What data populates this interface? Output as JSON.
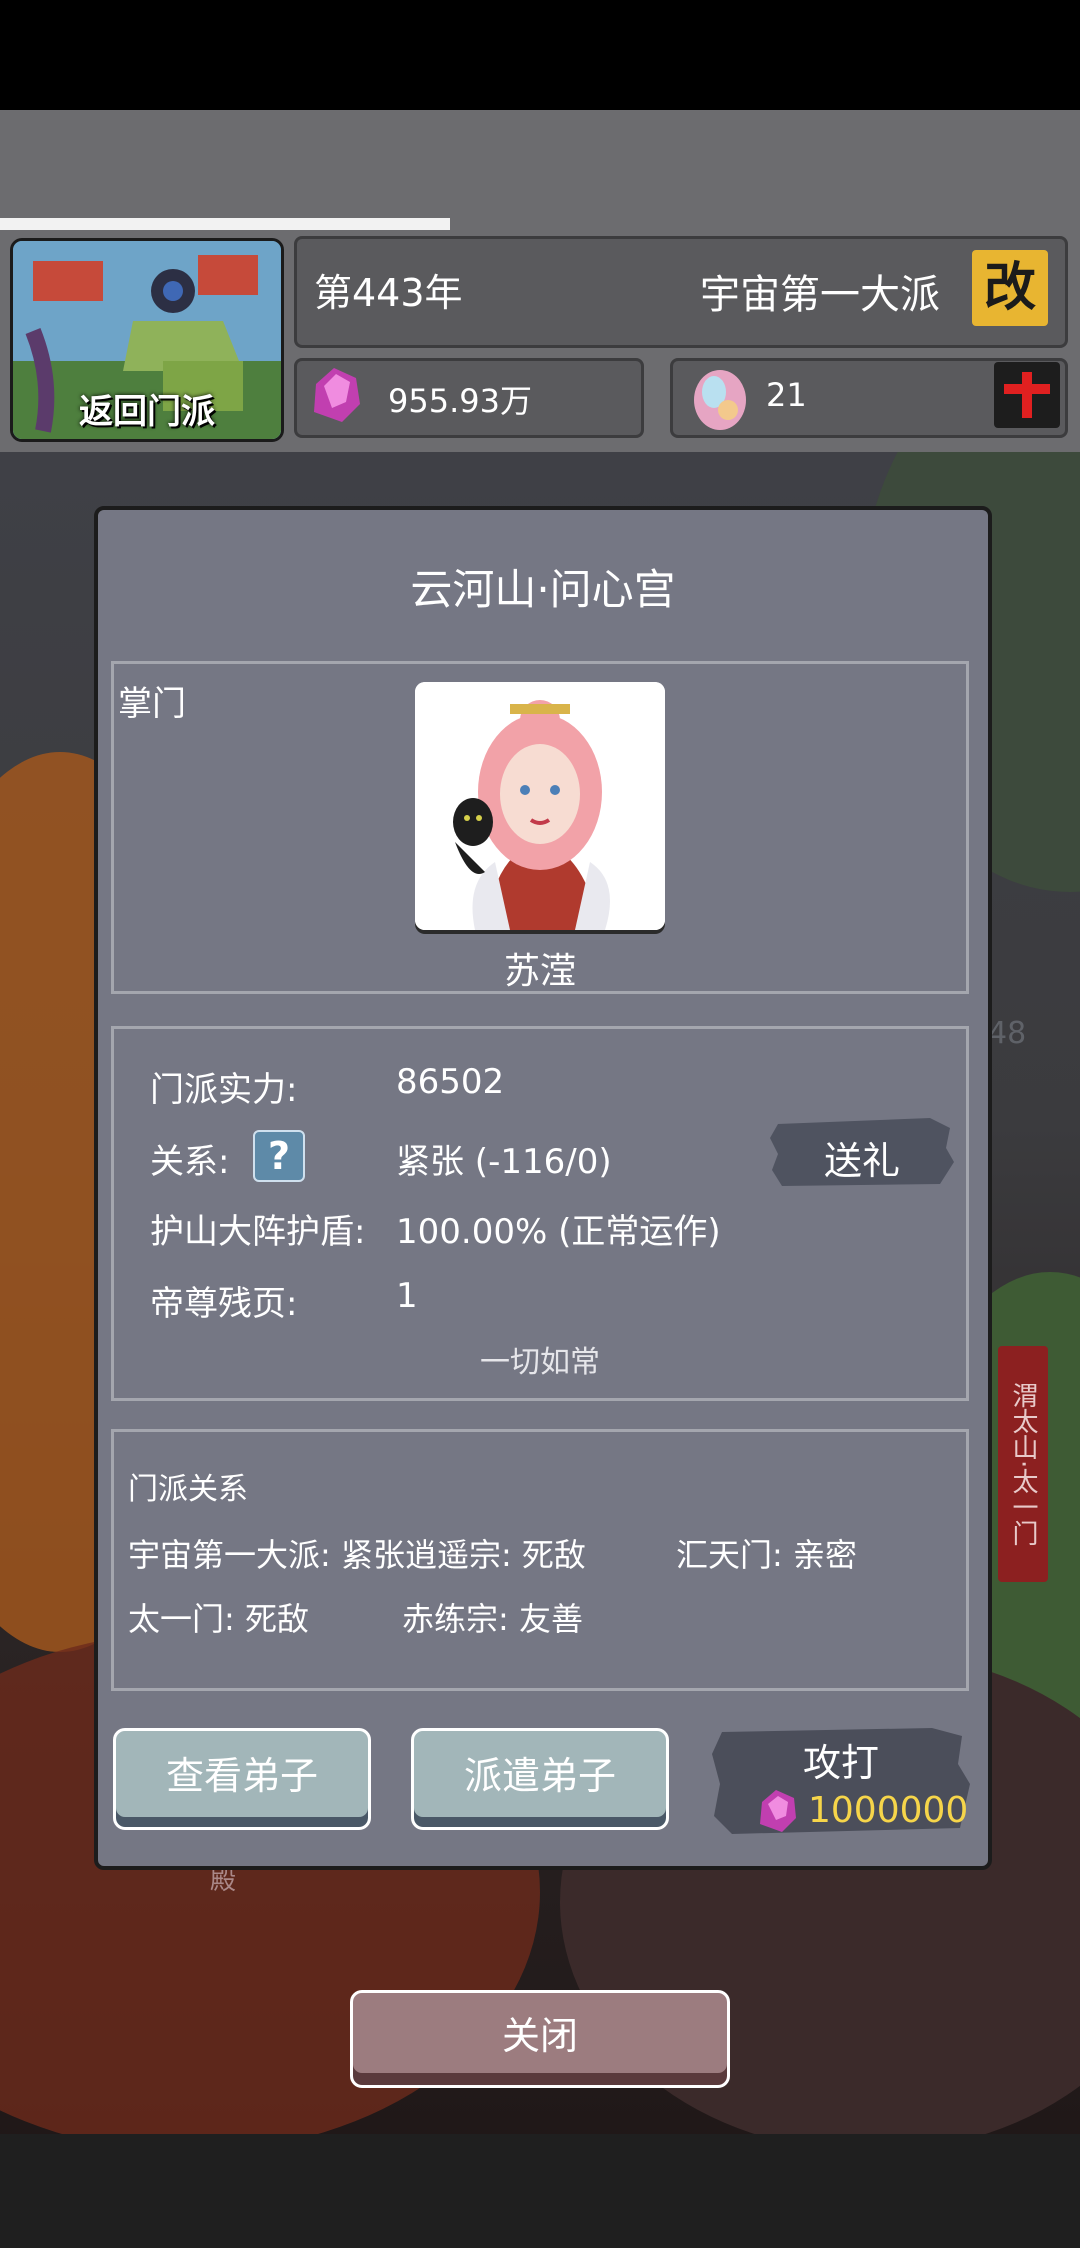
{
  "header": {
    "thumbnail_label": "返回门派",
    "year": "第443年",
    "sect_name": "宇宙第一大派",
    "rename_button": "改",
    "spirit_stones": "955.93万",
    "eggs": "21"
  },
  "dialog": {
    "title": "云河山·问心宫",
    "leader_label": "掌门",
    "leader_name": "苏滢",
    "stats": {
      "power_label": "门派实力:",
      "power_value": "86502",
      "relation_label": "关系:",
      "relation_value": "紧张  (-116/0)",
      "shield_label": "护山大阵护盾:",
      "shield_value": "100.00% (正常运作)",
      "pages_label": "帝尊残页:",
      "pages_value": "1",
      "status": "一切如常"
    },
    "gift_button": "送礼",
    "relations": {
      "title": "门派关系",
      "items": [
        "宇宙第一大派: 紧张逍遥宗: 死敌",
        "汇天门: 亲密",
        "太一门: 死敌",
        "赤练宗: 友善"
      ]
    },
    "buttons": {
      "view_disciples": "查看弟子",
      "dispatch_disciples": "派遣弟子",
      "attack": "攻打",
      "attack_cost": "1000000"
    }
  },
  "close_button": "关闭",
  "scene": {
    "banner_text": "渭太山·太一门",
    "side_number": "48",
    "hall_label": "殿"
  },
  "colors": {
    "dialog_bg": "#757784",
    "accent_gold": "#e8b531",
    "attack_cost": "#f6d54a",
    "close_button": "#9c7c7f"
  }
}
